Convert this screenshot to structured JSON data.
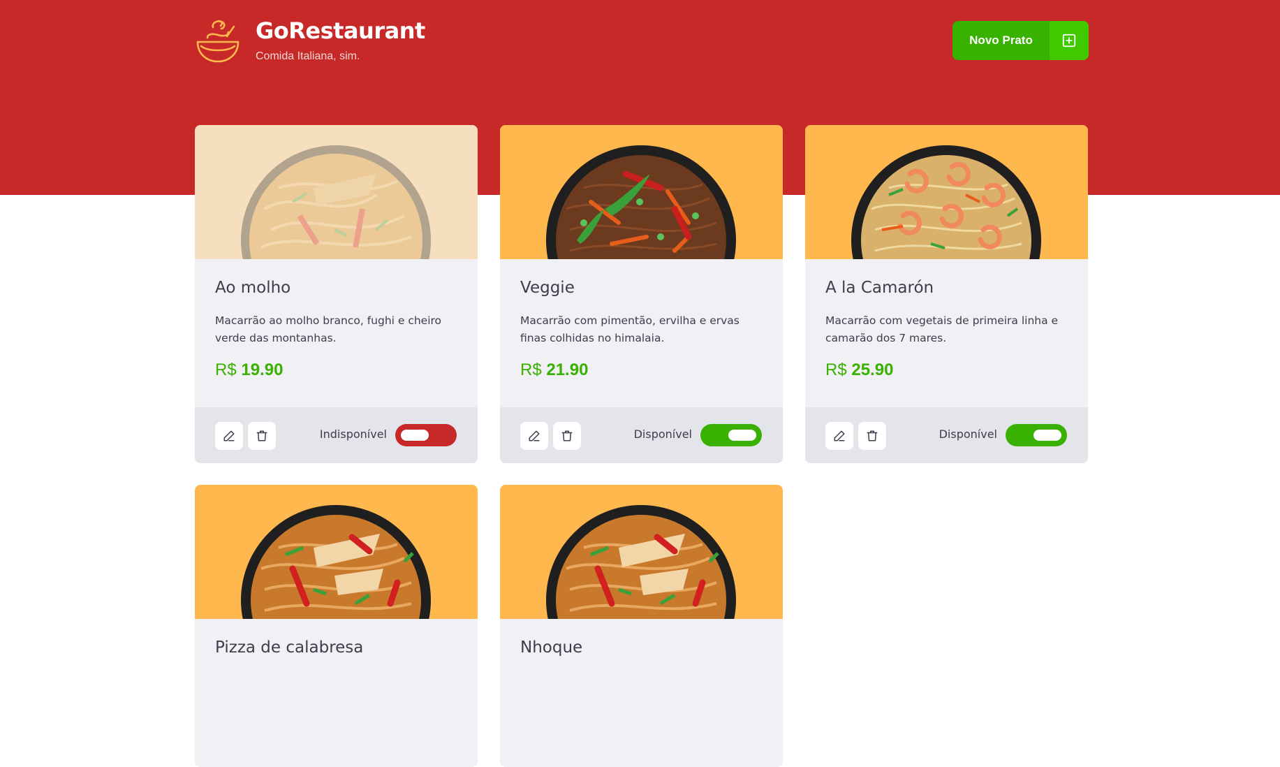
{
  "header": {
    "title": "GoRestaurant",
    "subtitle": "Comida Italiana, sim.",
    "new_button_label": "Novo Prato"
  },
  "colors": {
    "header_red": "#c72828",
    "accent_green": "#39b100",
    "image_bg": "#ffb84d",
    "card_bg": "#f0f0f5",
    "footer_bg": "#e4e4eb"
  },
  "foods": [
    {
      "name": "Ao molho",
      "description": "Macarrão ao molho branco, fughi e cheiro verde das montanhas.",
      "currency": "R$",
      "price": "19.90",
      "status": "Indisponível",
      "available": false
    },
    {
      "name": "Veggie",
      "description": "Macarrão com pimentão, ervilha e ervas finas colhidas no himalaia.",
      "currency": "R$",
      "price": "21.90",
      "status": "Disponível",
      "available": true
    },
    {
      "name": "A la Camarón",
      "description": "Macarrão com vegetais de primeira linha e camarão dos 7 mares.",
      "currency": "R$",
      "price": "25.90",
      "status": "Disponível",
      "available": true
    },
    {
      "name": "Pizza de calabresa"
    },
    {
      "name": "Nhoque"
    }
  ]
}
